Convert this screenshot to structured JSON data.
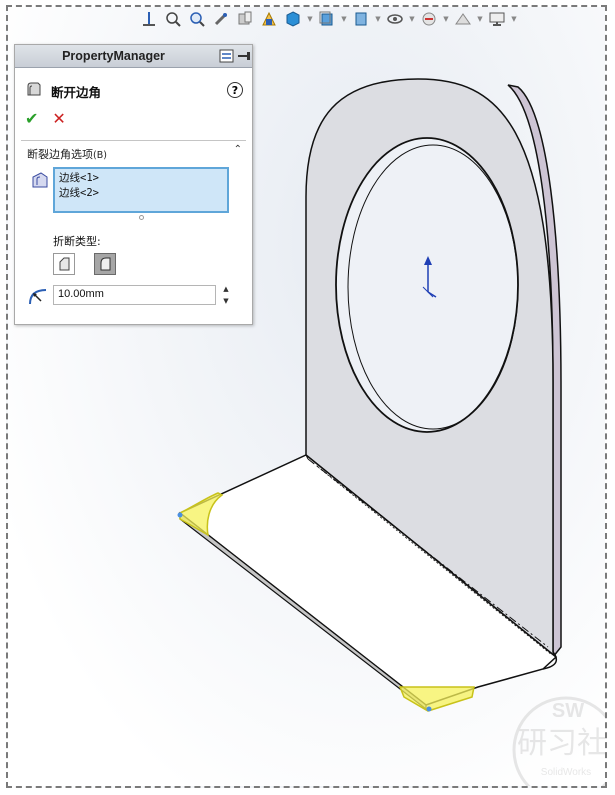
{
  "toolbar": {
    "icons": [
      "view-orientation-icon",
      "zoom-to-fit-icon",
      "zoom-area-icon",
      "previous-view-icon",
      "section-view-icon",
      "dynamic-annotation-icon",
      "view-orientation-cube-icon",
      "display-style-icon",
      "hide-show-items-icon",
      "edit-appearance-icon",
      "apply-scene-icon",
      "view-settings-icon"
    ]
  },
  "property_manager": {
    "header_title": "PropertyManager",
    "feature_title": "断开边角",
    "help_symbol": "?",
    "ok_symbol": "✔",
    "cancel_symbol": "✕",
    "group_title": "断裂边角选项",
    "group_title_hotkey": "(B)",
    "collapse_symbol": "⌃",
    "selections": [
      "边线<1>",
      "边线<2>"
    ],
    "break_type_label": "折断类型:",
    "break_types": [
      {
        "name": "chamfer",
        "active": false
      },
      {
        "name": "fillet",
        "active": true
      }
    ],
    "distance_value": "10.00mm",
    "spin_up": "▲",
    "spin_down": "▼"
  },
  "colors": {
    "panel_header": "#cfd4db",
    "selection_bg": "#cfe6f8",
    "selection_border": "#5fa6d9",
    "highlight": "#f5f25a",
    "part_face": "#dcdde2",
    "part_edge": "#111111",
    "axis_blue": "#1f3fb5"
  },
  "watermark": {
    "title": "SW",
    "chinese": "研习社",
    "subtitle": "SolidWorks"
  }
}
